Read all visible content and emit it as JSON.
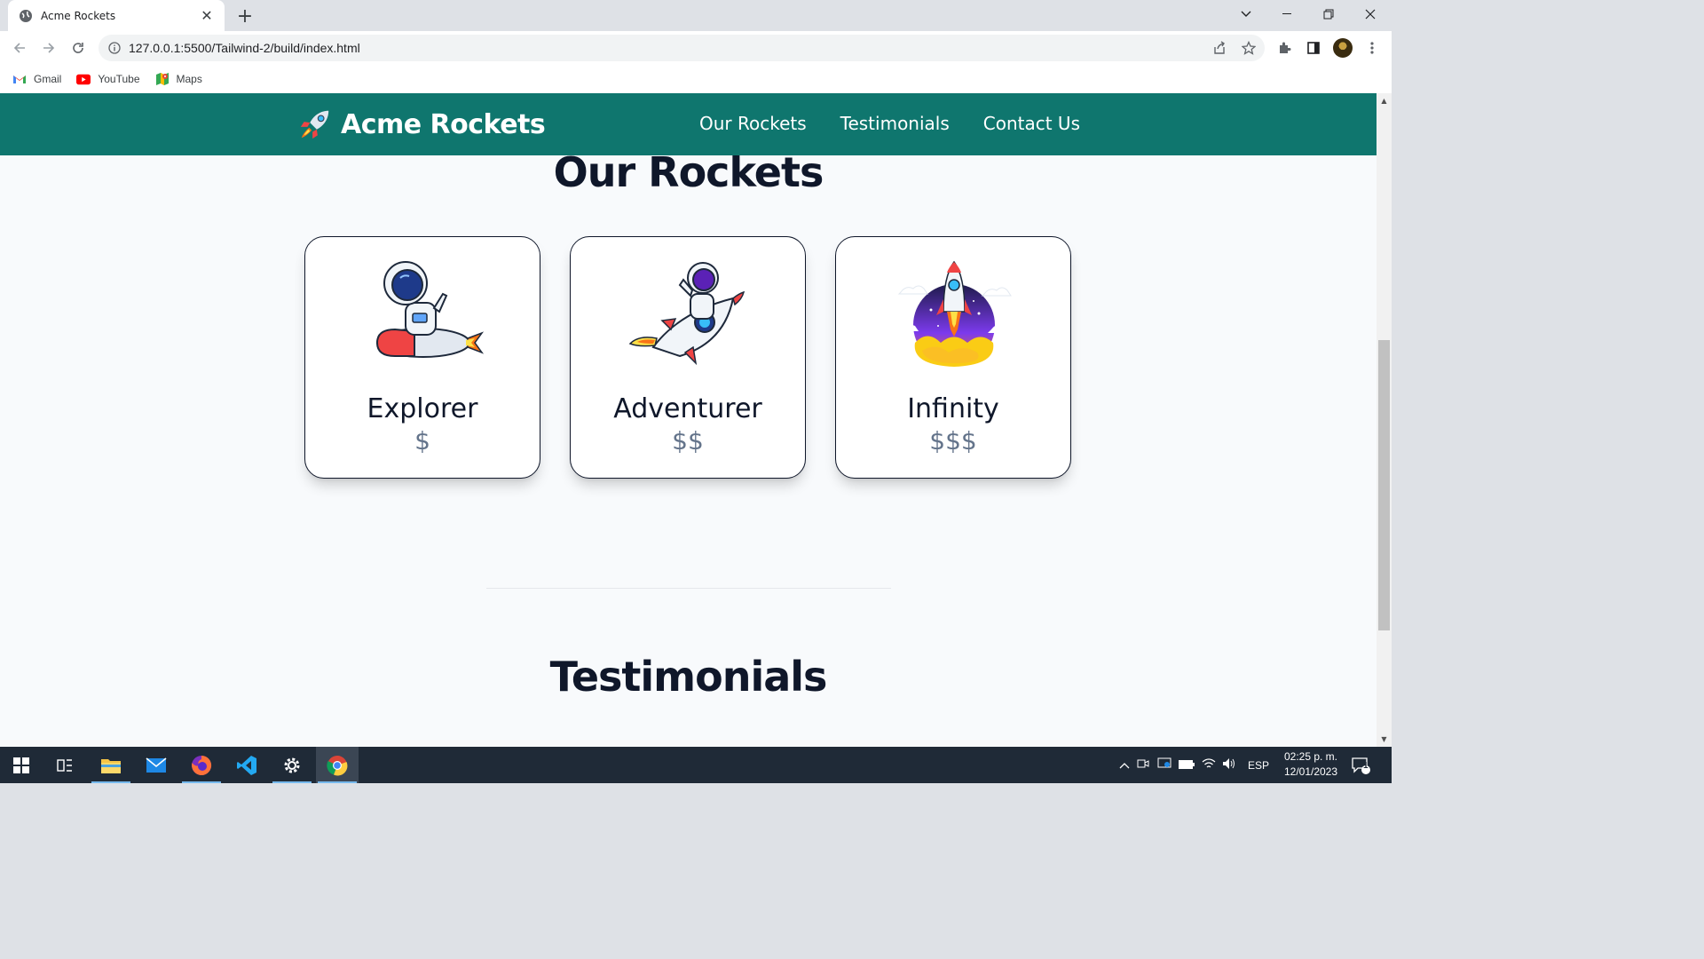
{
  "browser": {
    "tab_title": "Acme Rockets",
    "url": "127.0.0.1:5500/Tailwind-2/build/index.html",
    "bookmarks": [
      {
        "label": "Gmail",
        "icon": "gmail-icon"
      },
      {
        "label": "YouTube",
        "icon": "youtube-icon"
      },
      {
        "label": "Maps",
        "icon": "maps-icon"
      }
    ]
  },
  "site": {
    "brand": "Acme Rockets",
    "nav": [
      "Our Rockets",
      "Testimonials",
      "Contact Us"
    ],
    "header_color": "#0f766e"
  },
  "rockets_section": {
    "title": "Our Rockets",
    "cards": [
      {
        "name": "Explorer",
        "price": "$",
        "image": "astronaut-riding-rocket-icon"
      },
      {
        "name": "Adventurer",
        "price": "$$",
        "image": "astronaut-flying-rocket-icon"
      },
      {
        "name": "Infinity",
        "price": "$$$",
        "image": "rocket-launch-icon"
      }
    ]
  },
  "testimonials_section": {
    "title": "Testimonials"
  },
  "taskbar": {
    "language": "ESP",
    "time": "02:25 p. m.",
    "date": "12/01/2023",
    "notifications": "1"
  }
}
